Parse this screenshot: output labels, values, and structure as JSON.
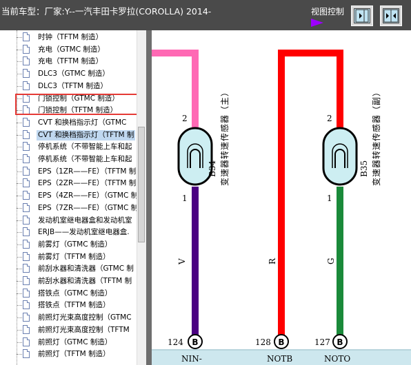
{
  "header": {
    "title": "当前车型：厂家:Y--一汽丰田卡罗拉(COROLLA) 2014-",
    "view_control_label": "视图控制"
  },
  "colors": {
    "accent_arrow": "#9d00ff",
    "selection_border": "#e53935",
    "wire_pink": "#ff69b4",
    "wire_red": "#ff0000",
    "wire_purple": "#4b0082",
    "wire_green": "#1a8a3a"
  },
  "sidebar": {
    "items": [
      {
        "label": "时钟（TFTM 制造）"
      },
      {
        "label": "充电（GTMC 制造）"
      },
      {
        "label": "充电（TFTM 制造）"
      },
      {
        "label": "DLC3（GTMC 制造）"
      },
      {
        "label": "DLC3（TFTM 制造）"
      },
      {
        "label": "门锁控制（GTMC 制造）"
      },
      {
        "label": "门锁控制（TFTM 制造）"
      },
      {
        "label": "CVT 和换档指示灯（GTMC"
      },
      {
        "label": "CVT 和换档指示灯（TFTM 制"
      },
      {
        "label": "停机系统（不带智能上车和起"
      },
      {
        "label": "停机系统（不带智能上车和起"
      },
      {
        "label": "EPS（1ZR——FE）（TFTM 制"
      },
      {
        "label": "EPS（2ZR——FE）（TFTM 制"
      },
      {
        "label": "EPS（4ZR——FE）（GTMC 制"
      },
      {
        "label": "EPS（7ZR——FE）（GTMC 制"
      },
      {
        "label": "发动机室继电器盒和发动机室"
      },
      {
        "label": "ERJB——发动机室继电器盒."
      },
      {
        "label": "前雾灯（GTMC 制造）"
      },
      {
        "label": "前雾灯（TFTM 制造）"
      },
      {
        "label": "前刮水器和清洗器（GTMC 制"
      },
      {
        "label": "前刮水器和清洗器（TFTM 制"
      },
      {
        "label": "搭铁点（GTMC 制造）"
      },
      {
        "label": "搭铁点（TFTM 制造）"
      },
      {
        "label": "前照灯光束高度控制（GTMC"
      },
      {
        "label": "前照灯光束高度控制（TFTM"
      },
      {
        "label": "前照灯（GTMC 制造）"
      },
      {
        "label": "前照灯（TFTM 制造）"
      }
    ]
  },
  "diagram": {
    "sensor_main": {
      "code": "B34",
      "name": "变速器转速传感器（主）",
      "pin_top": "2",
      "pin_bottom": "1"
    },
    "sensor_sub": {
      "code": "B35",
      "name": "变速器转速传感器（副）",
      "pin_top": "2",
      "pin_bottom": "1"
    },
    "wire_labels": {
      "purple": "V",
      "red": "R",
      "green": "G"
    },
    "terminals": [
      {
        "number": "124",
        "letter": "B",
        "signal": "NIN-"
      },
      {
        "number": "128",
        "letter": "B",
        "signal": "NOTB"
      },
      {
        "number": "127",
        "letter": "B",
        "signal": "NOTO"
      }
    ]
  }
}
